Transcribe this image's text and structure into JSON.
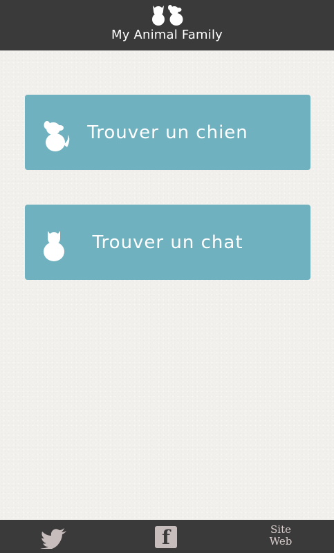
{
  "header": {
    "title": "My Animal Family",
    "logo_icon": "cat-and-dog-logo-icon"
  },
  "main": {
    "find_dog": {
      "label": "Trouver un chien",
      "icon": "dog-icon"
    },
    "find_cat": {
      "label": "Trouver un chat",
      "icon": "cat-icon"
    }
  },
  "footer": {
    "twitter": {
      "icon": "twitter-bird-icon"
    },
    "facebook": {
      "glyph": "f",
      "icon": "facebook-icon"
    },
    "site": {
      "line1": "Site",
      "line2": "Web"
    }
  },
  "colors": {
    "header_bg": "#3b3a3a",
    "button_bg": "#70b1bf",
    "page_bg": "#f2f0ec",
    "footer_icon": "#c7bdbd"
  }
}
